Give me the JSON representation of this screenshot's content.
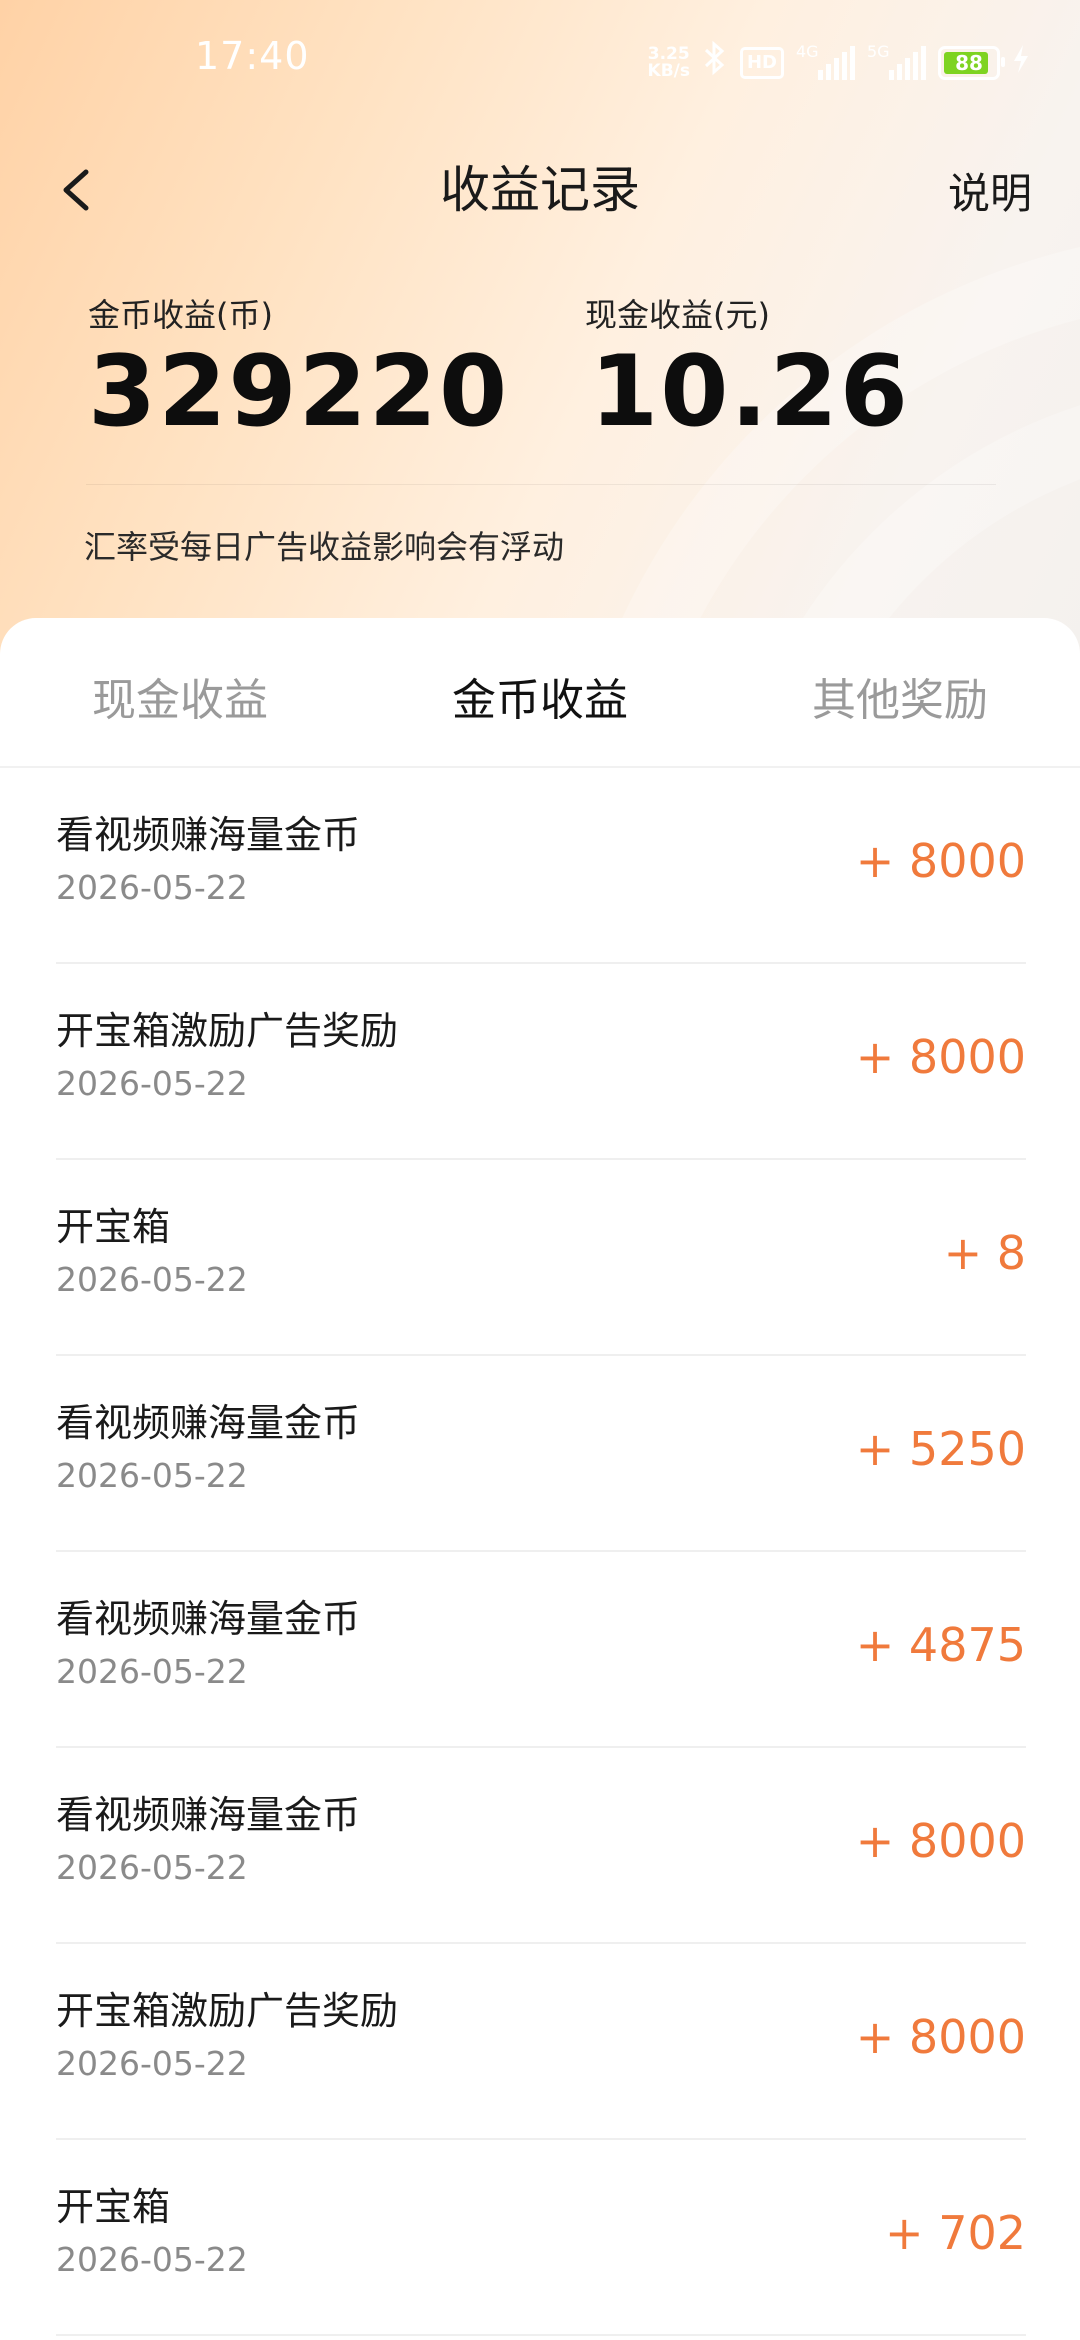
{
  "status_bar": {
    "time": "17:40",
    "net_speed_value": "3.25",
    "net_speed_unit": "KB/s",
    "hd_label": "HD",
    "sim1_label": "4G",
    "sim2_label": "5G",
    "battery": "88",
    "icons": [
      "bluetooth-icon",
      "signal-icon",
      "battery-icon",
      "charging-icon"
    ]
  },
  "nav": {
    "title": "收益记录",
    "help_label": "说明",
    "back_icon": "chevron-left-icon"
  },
  "summary": {
    "coin_label": "金币收益(币)",
    "coin_value": "329220",
    "cash_label": "现金收益(元)",
    "cash_value": "10.26",
    "note": "汇率受每日广告收益影响会有浮动"
  },
  "tabs": [
    {
      "label": "现金收益",
      "active": false
    },
    {
      "label": "金币收益",
      "active": true
    },
    {
      "label": "其他奖励",
      "active": false
    }
  ],
  "records": [
    {
      "title": "看视频赚海量金币",
      "date": "2026-05-22",
      "amount": "+ 8000"
    },
    {
      "title": "开宝箱激励广告奖励",
      "date": "2026-05-22",
      "amount": "+ 8000"
    },
    {
      "title": "开宝箱",
      "date": "2026-05-22",
      "amount": "+ 8"
    },
    {
      "title": "看视频赚海量金币",
      "date": "2026-05-22",
      "amount": "+ 5250"
    },
    {
      "title": "看视频赚海量金币",
      "date": "2026-05-22",
      "amount": "+ 4875"
    },
    {
      "title": "看视频赚海量金币",
      "date": "2026-05-22",
      "amount": "+ 8000"
    },
    {
      "title": "开宝箱激励广告奖励",
      "date": "2026-05-22",
      "amount": "+ 8000"
    },
    {
      "title": "开宝箱",
      "date": "2026-05-22",
      "amount": "+ 702"
    }
  ],
  "colors": {
    "accent_amount": "#f07a3c",
    "header_gradient_start": "#ffd2a6",
    "header_gradient_end": "#f4f1ee",
    "battery_fill": "#7ed321"
  }
}
